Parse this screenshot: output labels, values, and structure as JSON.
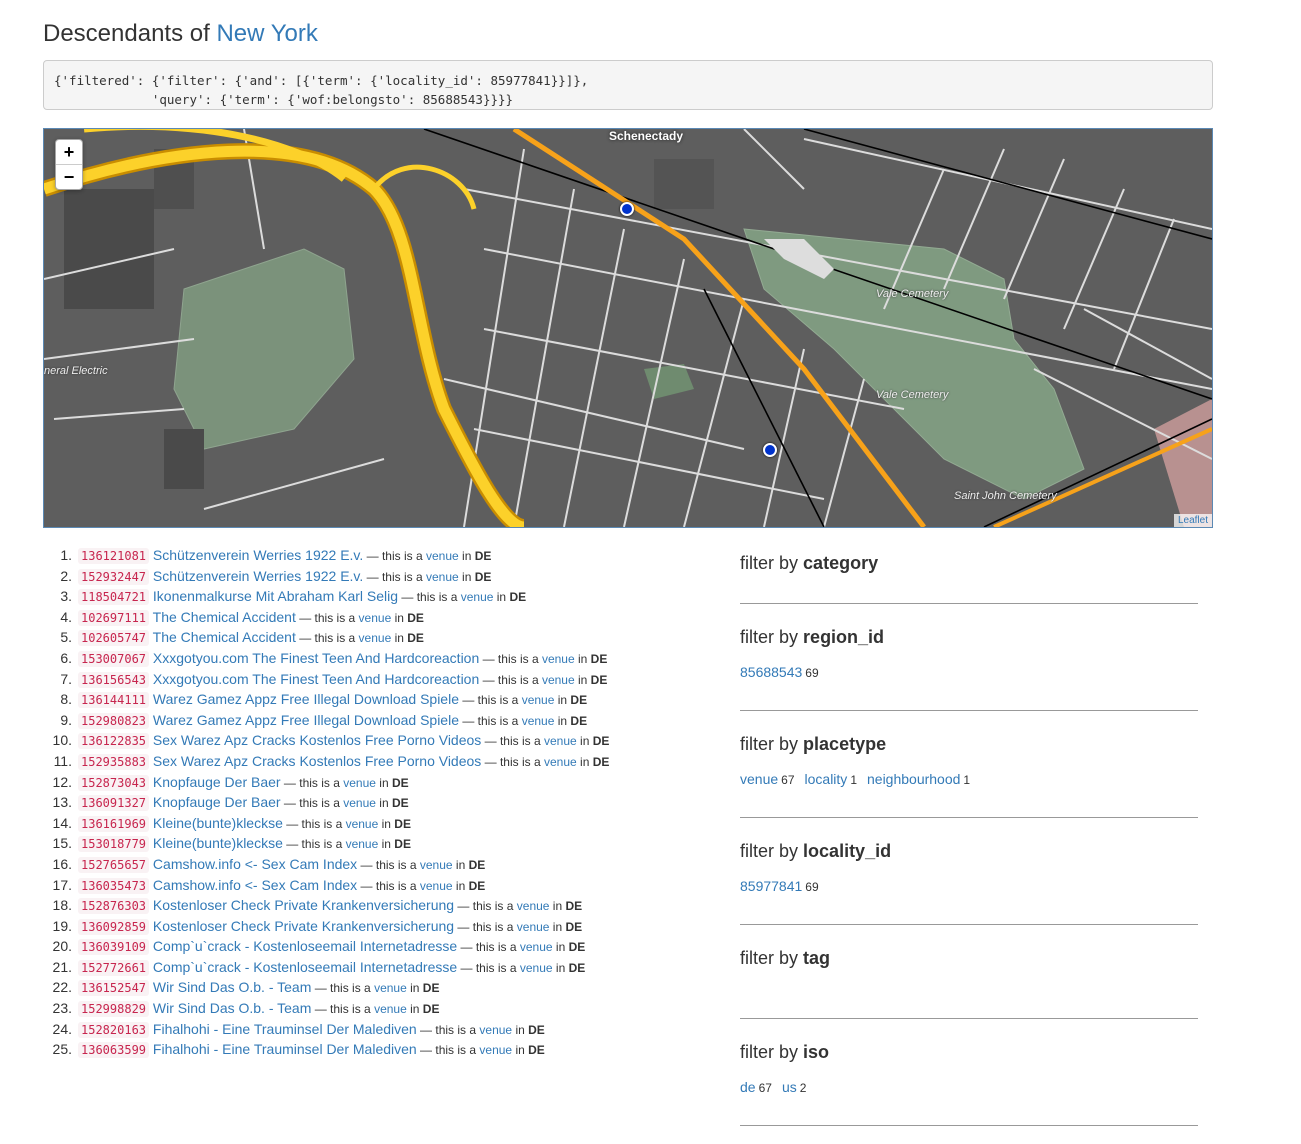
{
  "header": {
    "prefix": "Descendants of",
    "place": "New York"
  },
  "query_text": "{'filtered': {'filter': {'and': [{'term': {'locality_id': 85977841}}]},\n             'query': {'term': {'wof:belongsto': 85688543}}}}",
  "map": {
    "zoom_in": "+",
    "zoom_out": "−",
    "attribution": "Leaflet",
    "labels": {
      "city": "Schenectady",
      "ge": "neral Electric",
      "vale1": "Vale Cemetery",
      "vale2": "Vale Cemetery",
      "stjohn": "Saint John Cemetery"
    }
  },
  "results": [
    {
      "n": "1.",
      "id": "136121081",
      "name": "Schützenverein Werries 1922 E.v.",
      "pt": "venue",
      "iso": "DE"
    },
    {
      "n": "2.",
      "id": "152932447",
      "name": "Schützenverein Werries 1922 E.v.",
      "pt": "venue",
      "iso": "DE"
    },
    {
      "n": "3.",
      "id": "118504721",
      "name": "Ikonenmalkurse Mit Abraham Karl Selig",
      "pt": "venue",
      "iso": "DE"
    },
    {
      "n": "4.",
      "id": "102697111",
      "name": "The Chemical Accident",
      "pt": "venue",
      "iso": "DE"
    },
    {
      "n": "5.",
      "id": "102605747",
      "name": "The Chemical Accident",
      "pt": "venue",
      "iso": "DE"
    },
    {
      "n": "6.",
      "id": "153007067",
      "name": "Xxxgotyou.com The Finest Teen And Hardcoreaction",
      "pt": "venue",
      "iso": "DE"
    },
    {
      "n": "7.",
      "id": "136156543",
      "name": "Xxxgotyou.com The Finest Teen And Hardcoreaction",
      "pt": "venue",
      "iso": "DE"
    },
    {
      "n": "8.",
      "id": "136144111",
      "name": "Warez Gamez Appz Free Illegal Download Spiele",
      "pt": "venue",
      "iso": "DE"
    },
    {
      "n": "9.",
      "id": "152980823",
      "name": "Warez Gamez Appz Free Illegal Download Spiele",
      "pt": "venue",
      "iso": "DE"
    },
    {
      "n": "10.",
      "id": "136122835",
      "name": "Sex Warez Apz Cracks Kostenlos Free Porno Videos",
      "pt": "venue",
      "iso": "DE"
    },
    {
      "n": "11.",
      "id": "152935883",
      "name": "Sex Warez Apz Cracks Kostenlos Free Porno Videos",
      "pt": "venue",
      "iso": "DE"
    },
    {
      "n": "12.",
      "id": "152873043",
      "name": "Knopfauge Der Baer",
      "pt": "venue",
      "iso": "DE"
    },
    {
      "n": "13.",
      "id": "136091327",
      "name": "Knopfauge Der Baer",
      "pt": "venue",
      "iso": "DE"
    },
    {
      "n": "14.",
      "id": "136161969",
      "name": "Kleine(bunte)kleckse",
      "pt": "venue",
      "iso": "DE"
    },
    {
      "n": "15.",
      "id": "153018779",
      "name": "Kleine(bunte)kleckse",
      "pt": "venue",
      "iso": "DE"
    },
    {
      "n": "16.",
      "id": "152765657",
      "name": "Camshow.info <- Sex Cam Index",
      "pt": "venue",
      "iso": "DE"
    },
    {
      "n": "17.",
      "id": "136035473",
      "name": "Camshow.info <- Sex Cam Index",
      "pt": "venue",
      "iso": "DE"
    },
    {
      "n": "18.",
      "id": "152876303",
      "name": "Kostenloser Check Private Krankenversicherung",
      "pt": "venue",
      "iso": "DE"
    },
    {
      "n": "19.",
      "id": "136092859",
      "name": "Kostenloser Check Private Krankenversicherung",
      "pt": "venue",
      "iso": "DE"
    },
    {
      "n": "20.",
      "id": "136039109",
      "name": "Comp`u`crack - Kostenloseemail Internetadresse",
      "pt": "venue",
      "iso": "DE"
    },
    {
      "n": "21.",
      "id": "152772661",
      "name": "Comp`u`crack - Kostenloseemail Internetadresse",
      "pt": "venue",
      "iso": "DE"
    },
    {
      "n": "22.",
      "id": "136152547",
      "name": "Wir Sind Das O.b. - Team",
      "pt": "venue",
      "iso": "DE"
    },
    {
      "n": "23.",
      "id": "152998829",
      "name": "Wir Sind Das O.b. - Team",
      "pt": "venue",
      "iso": "DE"
    },
    {
      "n": "24.",
      "id": "152820163",
      "name": "Fihalhohi - Eine Trauminsel Der Malediven",
      "pt": "venue",
      "iso": "DE"
    },
    {
      "n": "25.",
      "id": "136063599",
      "name": "Fihalhohi - Eine Trauminsel Der Malediven",
      "pt": "venue",
      "iso": "DE"
    }
  ],
  "result_text": {
    "sep": " — this is a ",
    "in": " in "
  },
  "facets": {
    "prefix": "filter by",
    "groups": [
      {
        "key": "category",
        "values": []
      },
      {
        "key": "region_id",
        "values": [
          {
            "label": "85688543",
            "count": "69"
          }
        ]
      },
      {
        "key": "placetype",
        "values": [
          {
            "label": "venue",
            "count": "67"
          },
          {
            "label": "locality",
            "count": "1"
          },
          {
            "label": "neighbourhood",
            "count": "1"
          }
        ]
      },
      {
        "key": "locality_id",
        "values": [
          {
            "label": "85977841",
            "count": "69"
          }
        ]
      },
      {
        "key": "tag",
        "values": []
      },
      {
        "key": "iso",
        "values": [
          {
            "label": "de",
            "count": "67"
          },
          {
            "label": "us",
            "count": "2"
          }
        ]
      }
    ]
  }
}
